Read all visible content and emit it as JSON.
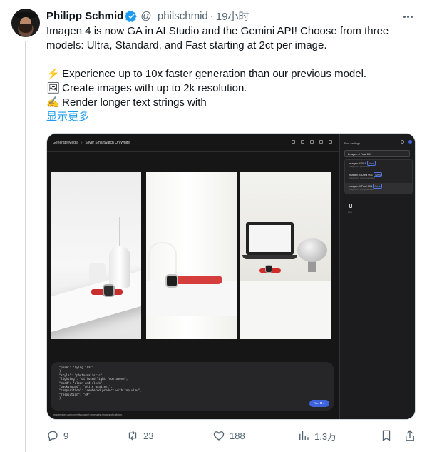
{
  "author": {
    "name": "Philipp Schmid",
    "handle": "@_philschmid",
    "time": "19小时"
  },
  "tweet": {
    "line1": "Imagen 4 is now GA in AI Studio and the Gemini API! Choose from three",
    "line2": "models: Ultra, Standard, and Fast starting at 2ct per image.",
    "bullet1_emoji": "⚡",
    "bullet1": "Experience up to 10x faster generation than our previous model.",
    "bullet2_emoji": "🖼",
    "bullet2": "Create images with up to 2k resolution.",
    "bullet3_emoji": "✍",
    "bullet3": "Render longer text strings with",
    "show_more": "显示更多"
  },
  "screenshot": {
    "breadcrumb_root": "Generate Media",
    "breadcrumb_title": "Silver Smartwatch On White",
    "run_settings": "Run settings",
    "selected_model": "Imagen 4 Fast 001",
    "models": [
      {
        "name": "Imagen 4 001",
        "tag": "New",
        "desc": "Imagen 4.0 generation"
      },
      {
        "name": "Imagen 4 Ultra 001",
        "tag": "New",
        "desc": "Imagen 4.0 ultra generation"
      },
      {
        "name": "Imagen 4 Fast 001",
        "tag": "New",
        "desc": "Imagen 4.0 fast generation"
      }
    ],
    "aspect_ratio": "3:4",
    "prompt": "\"pose\": \"lying flat\"\n}\n\"style\": \"photorealistic\",\n\"lighting\": \"diffused light from above\",\n\"mood\": \"clean and sleek\",\n\"background\": \"white gradient\",\n\"composition\": \"centered product with top view\",\n\"resolution\": \"4K\"\n}",
    "run_button": "Run ⌘↵",
    "notice": "Imagen does not currently support generating images of children."
  },
  "metrics": {
    "replies": "9",
    "reposts": "23",
    "likes": "188",
    "views": "1.3万"
  },
  "colors": {
    "link": "#1d9bf0",
    "muted": "#536471",
    "verified": "#1d9bf0"
  }
}
